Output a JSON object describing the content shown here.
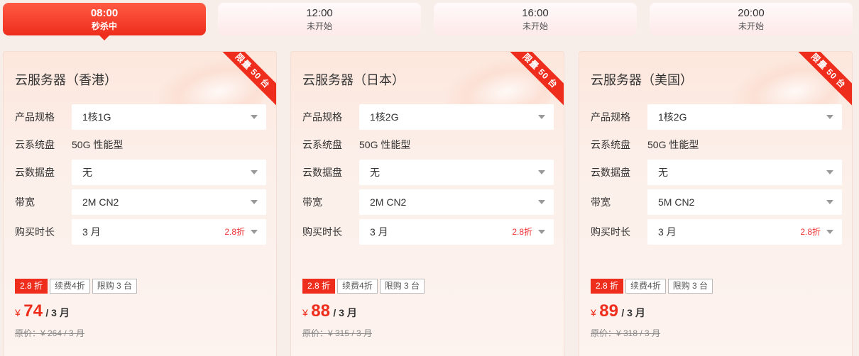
{
  "tabs": [
    {
      "time": "08:00",
      "state": "秒杀中",
      "active": true
    },
    {
      "time": "12:00",
      "state": "未开始",
      "active": false
    },
    {
      "time": "16:00",
      "state": "未开始",
      "active": false
    },
    {
      "time": "20:00",
      "state": "未开始",
      "active": false
    }
  ],
  "labels": {
    "spec": "产品规格",
    "system_disk": "云系统盘",
    "data_disk": "云数据盘",
    "bandwidth": "带宽",
    "duration": "购买时长"
  },
  "cards": [
    {
      "title": "云服务器（香港）",
      "ribbon": "限量 50 台",
      "spec": "1核1G",
      "system_disk": "50G 性能型",
      "data_disk": "无",
      "bandwidth": "2M CN2",
      "duration": "3 月",
      "duration_discount": "2.8折",
      "badges": [
        "2.8 折",
        "续费4折",
        "限购 3 台"
      ],
      "currency": "¥",
      "price": "74",
      "per": "/ 3 月",
      "original": "原价：¥ 264 / 3 月"
    },
    {
      "title": "云服务器（日本）",
      "ribbon": "限量 50 台",
      "spec": "1核2G",
      "system_disk": "50G 性能型",
      "data_disk": "无",
      "bandwidth": "2M CN2",
      "duration": "3 月",
      "duration_discount": "2.8折",
      "badges": [
        "2.8 折",
        "续费4折",
        "限购 3 台"
      ],
      "currency": "¥",
      "price": "88",
      "per": "/ 3 月",
      "original": "原价：¥ 315 / 3 月"
    },
    {
      "title": "云服务器（美国）",
      "ribbon": "限量 50 台",
      "spec": "1核2G",
      "system_disk": "50G 性能型",
      "data_disk": "无",
      "bandwidth": "5M CN2",
      "duration": "3 月",
      "duration_discount": "2.8折",
      "badges": [
        "2.8 折",
        "续费4折",
        "限购 3 台"
      ],
      "currency": "¥",
      "price": "89",
      "per": "/ 3 月",
      "original": "原价：¥ 318 / 3 月"
    }
  ],
  "colors": {
    "accent": "#ee2d1c",
    "card_bg": "#fdeee8"
  }
}
